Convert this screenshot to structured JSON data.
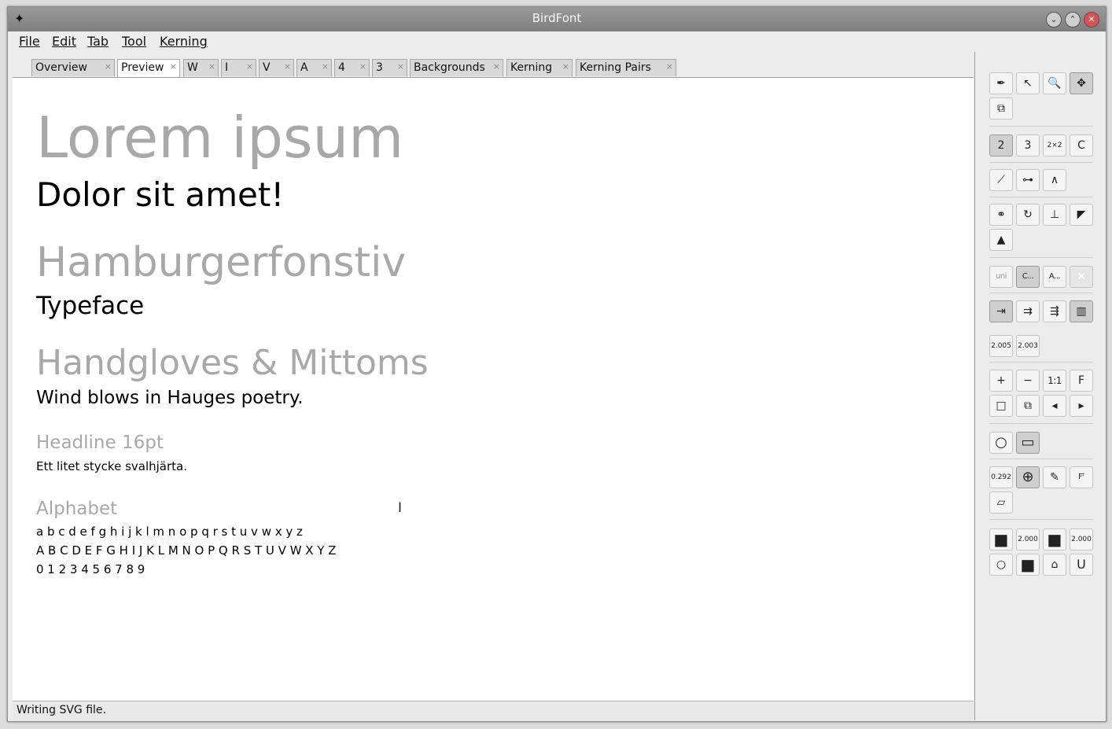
{
  "window": {
    "title": "BirdFont",
    "controls": {
      "minimize": "⌄",
      "maximize": "⌃",
      "close": "✕"
    }
  },
  "menu": [
    "File",
    "Edit",
    "Tab",
    "Tool",
    "Kerning"
  ],
  "tabs": [
    {
      "label": "Overview",
      "close": "×"
    },
    {
      "label": "Preview",
      "close": "×"
    },
    {
      "label": "W",
      "close": "×"
    },
    {
      "label": "I",
      "close": "×"
    },
    {
      "label": "V",
      "close": "×"
    },
    {
      "label": "A",
      "close": "×"
    },
    {
      "label": "4",
      "close": "×"
    },
    {
      "label": "3",
      "close": "×"
    },
    {
      "label": "Backgrounds",
      "close": "×"
    },
    {
      "label": "Kerning",
      "close": "×"
    },
    {
      "label": "Kerning Pairs",
      "close": "×"
    }
  ],
  "preview": {
    "lines": [
      "Lorem ipsum",
      "Dolor sit amet!",
      "Hamburgerfonstiv",
      "Typeface",
      "Handgloves & Mittoms",
      "Wind blows in Hauges poetry.",
      "Headline 16pt",
      "Ett litet stycke svalhjärta.",
      "Alphabet",
      "a b c d e f g h i j k l m n o p q r s t u v w x y z",
      "A B C D E F G H I J K L M N O P Q R S T U V W X Y Z",
      "0 1 2 3 4 5 6 7 8 9"
    ],
    "cursor": "I"
  },
  "status": "Writing SVG file.",
  "toolbox": {
    "draw_tools": [
      {
        "name": "pen-tool-icon",
        "glyph": "✒"
      },
      {
        "name": "pointer-tool-icon",
        "glyph": "↖"
      },
      {
        "name": "zoom-tool-icon",
        "glyph": "🔍"
      },
      {
        "name": "move-tool-icon",
        "glyph": "✥"
      },
      {
        "name": "resize-tool-icon",
        "glyph": "⧉"
      }
    ],
    "point_types": [
      {
        "name": "quadratic-points-button",
        "label": "2"
      },
      {
        "name": "cubic-points-button",
        "label": "3"
      },
      {
        "name": "double-points-button",
        "label": "2×2"
      },
      {
        "name": "convert-points-button",
        "label": "C"
      }
    ],
    "handle_tools": [
      {
        "name": "handle-tangent-icon",
        "glyph": "⟋"
      },
      {
        "name": "handle-line-icon",
        "glyph": "⊶"
      },
      {
        "name": "handle-curve-icon",
        "glyph": "∧"
      }
    ],
    "path_tools": [
      {
        "name": "link-paths-icon",
        "glyph": "⚭"
      },
      {
        "name": "reverse-path-icon",
        "glyph": "↻"
      },
      {
        "name": "baseline-icon",
        "glyph": "⊥"
      },
      {
        "name": "stroke-taper-icon",
        "glyph": "◤"
      },
      {
        "name": "knife-tool-icon",
        "glyph": "▲"
      }
    ],
    "characterset": [
      {
        "name": "unicode-button",
        "label": "uni"
      },
      {
        "name": "characters-button",
        "label": "C..."
      },
      {
        "name": "alphabet-button",
        "label": "A..."
      },
      {
        "name": "clear-button",
        "label": "✕"
      }
    ],
    "guides": [
      {
        "name": "guide-left-icon",
        "glyph": "⇥"
      },
      {
        "name": "guide-right-icon",
        "glyph": "⇉"
      },
      {
        "name": "guide-both-icon",
        "glyph": "⇶"
      },
      {
        "name": "grid-icon",
        "glyph": "▥"
      }
    ],
    "grid_values": [
      "2.005",
      "2.003"
    ],
    "zoom": [
      {
        "name": "zoom-in-button",
        "label": "+"
      },
      {
        "name": "zoom-out-button",
        "label": "−"
      },
      {
        "name": "zoom-1to1-button",
        "label": "1:1"
      },
      {
        "name": "zoom-fit-button",
        "label": "F"
      },
      {
        "name": "view-square-icon",
        "label": "□"
      },
      {
        "name": "view-layers-icon",
        "label": "⧉"
      },
      {
        "name": "previous-view-icon",
        "label": "◂"
      },
      {
        "name": "next-view-icon",
        "label": "▸"
      }
    ],
    "shapes": [
      {
        "name": "circle-tool-icon",
        "glyph": "○"
      },
      {
        "name": "rectangle-tool-icon",
        "glyph": "▭"
      }
    ],
    "transform": [
      {
        "name": "transform-value",
        "label": "0.292"
      },
      {
        "name": "rotate-tool-icon",
        "glyph": "⊕"
      },
      {
        "name": "eraser-tool-icon",
        "glyph": "✎"
      },
      {
        "name": "font-size-icon",
        "glyph": "Fᶠ"
      },
      {
        "name": "skew-tool-icon",
        "glyph": "▱"
      }
    ],
    "stroke": [
      {
        "name": "fill-black-icon",
        "label": "■"
      },
      {
        "name": "stroke-width-value",
        "label": "2.000"
      },
      {
        "name": "fill-black-2-icon",
        "label": "■"
      },
      {
        "name": "stroke-width-2-value",
        "label": "2.000"
      },
      {
        "name": "outline-icon",
        "label": "○"
      },
      {
        "name": "fill-black-3-icon",
        "label": "■"
      },
      {
        "name": "stamp-icon",
        "label": "⌂"
      },
      {
        "name": "union-icon",
        "label": "U"
      }
    ]
  }
}
